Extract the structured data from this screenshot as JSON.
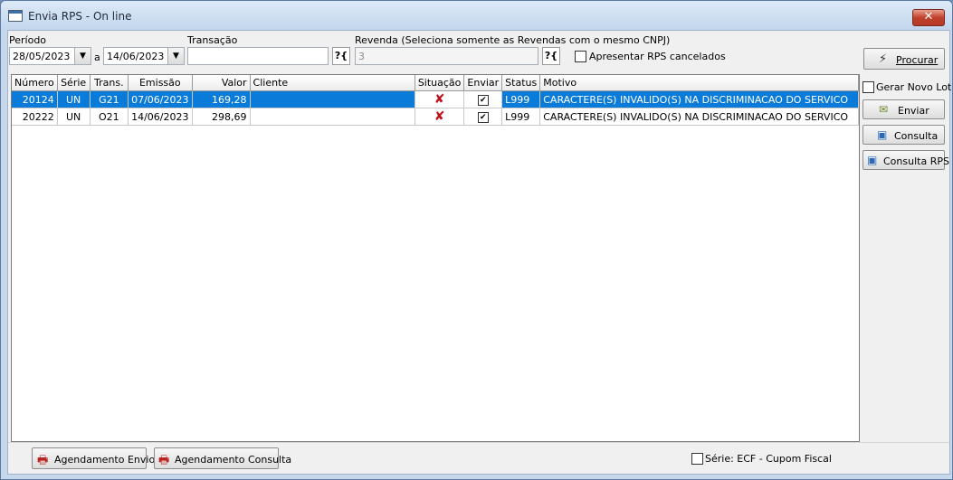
{
  "window": {
    "title": "Envia RPS - On line",
    "close": "✕"
  },
  "filters": {
    "periodo_label": "Período",
    "date_from": "28/05/2023",
    "sep": "a",
    "date_to": "14/06/2023",
    "transacao_label": "Transação",
    "transacao_value": "",
    "lookup": "?{",
    "revenda_label": "Revenda (Seleciona somente as Revendas com o mesmo CNPJ)",
    "revenda_value": "3",
    "cancelados_label": "Apresentar RPS cancelados"
  },
  "buttons": {
    "procurar": "Procurar",
    "gerar_novo_lote": "Gerar Novo Lote",
    "enviar": "Enviar",
    "consulta": "Consulta",
    "consulta_rps": "Consulta RPS",
    "agendamento_envio": "Agendamento Envio",
    "agendamento_consulta": "Agendamento Consulta",
    "serie_ecf": "Série: ECF - Cupom Fiscal"
  },
  "table": {
    "columns": [
      "Número",
      "Série",
      "Trans.",
      "Emissão",
      "Valor",
      "Cliente",
      "Situação",
      "Enviar",
      "Status",
      "Motivo"
    ],
    "rows": [
      {
        "numero": "20124",
        "serie": "UN",
        "trans": "G21",
        "emissao": "07/06/2023",
        "valor": "169,28",
        "cliente": "",
        "situacao": "x-icon",
        "enviar": true,
        "status": "L999",
        "motivo": "CARACTERE(S) INVALIDO(S) NA DISCRIMINACAO DO SERVICO",
        "selected": true
      },
      {
        "numero": "20222",
        "serie": "UN",
        "trans": "O21",
        "emissao": "14/06/2023",
        "valor": "298,69",
        "cliente": "",
        "situacao": "x-icon",
        "enviar": true,
        "status": "L999",
        "motivo": "CARACTERE(S) INVALIDO(S) NA DISCRIMINACAO DO SERVICO",
        "selected": false
      }
    ]
  },
  "colors": {
    "selection": "#0a7bd8",
    "error_mark": "#c0101a"
  }
}
